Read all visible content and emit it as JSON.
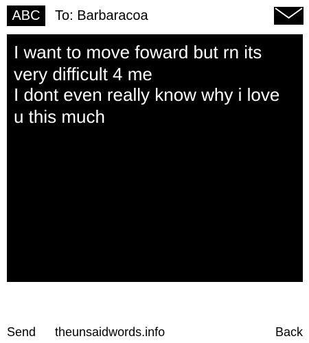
{
  "header": {
    "mode_label": "ABC",
    "recipient": "To: Barbaracoa",
    "icon": "envelope-icon"
  },
  "message": {
    "lines": [
      "I want to move foward but rn its very difficult 4 me",
      "I dont even really know why i love u this much"
    ]
  },
  "footer": {
    "send_label": "Send",
    "site_label": "theunsaidwords.info",
    "back_label": "Back"
  },
  "colors": {
    "background": "#ffffff",
    "panel": "#000000",
    "text_on_panel": "#ffffff"
  }
}
